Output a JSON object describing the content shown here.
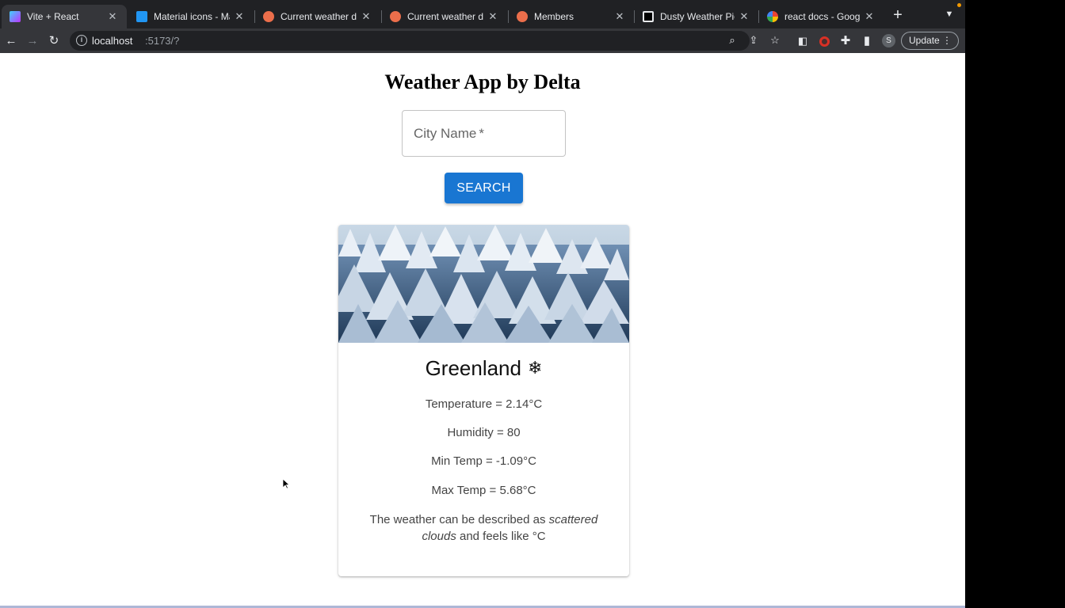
{
  "browser": {
    "tabs": [
      {
        "title": "Vite + React",
        "favicon": "vite-icon",
        "active": true
      },
      {
        "title": "Material icons - Mate",
        "favicon": "mui-icon",
        "active": false
      },
      {
        "title": "Current weather data",
        "favicon": "openweather-icon",
        "active": false
      },
      {
        "title": "Current weather data",
        "favicon": "openweather-icon",
        "active": false
      },
      {
        "title": "Members",
        "favicon": "openweather-icon",
        "active": false
      },
      {
        "title": "Dusty Weather Pictur",
        "favicon": "unsplash-icon",
        "active": false
      },
      {
        "title": "react docs - Google",
        "favicon": "google-icon",
        "active": false
      }
    ],
    "address_host": "localhost",
    "address_path": ":5173/?",
    "profile_initial": "S",
    "update_label": "Update",
    "colors": {
      "frame": "#202124",
      "toolbar": "#35363a",
      "accent": "#f29900"
    }
  },
  "app": {
    "title": "Weather App by Delta",
    "city_input": {
      "label": "City Name",
      "required_marker": "*",
      "value": ""
    },
    "search_label": "SEARCH",
    "colors": {
      "button": "#1976d2"
    },
    "card": {
      "city": "Greenland",
      "weather_icon": "snowflake-icon",
      "temperature": "Temperature = 2.14°C",
      "humidity": "Humidity = 80",
      "min_temp": "Min Temp = -1.09°C",
      "max_temp": "Max Temp = 5.68°C",
      "description_pre": "The weather can be described as ",
      "description_weather": "scattered clouds",
      "description_post": " and feels like °C"
    }
  }
}
